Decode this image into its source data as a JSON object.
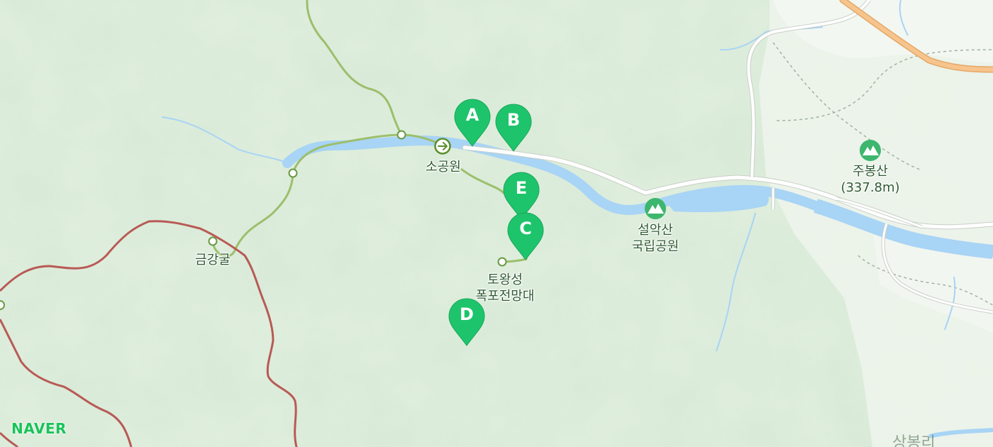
{
  "map": {
    "colors": {
      "background": "#dfeedd",
      "water": "#a8d4f5",
      "road": "#ffffff",
      "highway": "#f4b97a",
      "trail_green": "#9cbf6c",
      "trail_red": "#b85a55",
      "pin": "#1ec46b",
      "label": "#2e5a32",
      "brand": "#19c35a"
    },
    "labels": {
      "sogongwon": "소공원",
      "geumganggul": "금강굴",
      "towangseong_line1": "토왕성",
      "towangseong_line2": "폭포전망대",
      "seoraksan_line1": "설악산",
      "seoraksan_line2": "국립공원",
      "jubongsan_line1": "주봉산",
      "jubongsan_line2": "(337.8m)",
      "cut_off": "상봉리"
    },
    "markers": [
      {
        "letter": "A"
      },
      {
        "letter": "B"
      },
      {
        "letter": "E"
      },
      {
        "letter": "C"
      },
      {
        "letter": "D"
      }
    ],
    "icons": {
      "seoraksan": "mountain-icon",
      "jubongsan": "mountain-icon",
      "sogongwon": "arrow-right-icon"
    },
    "brand": "NAVER"
  }
}
